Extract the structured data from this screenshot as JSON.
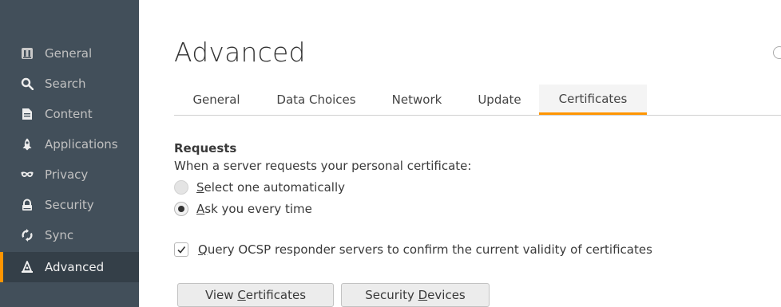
{
  "sidebar": {
    "items": [
      {
        "label": "General",
        "icon": "general-icon"
      },
      {
        "label": "Search",
        "icon": "search-icon"
      },
      {
        "label": "Content",
        "icon": "content-icon"
      },
      {
        "label": "Applications",
        "icon": "applications-icon"
      },
      {
        "label": "Privacy",
        "icon": "privacy-icon"
      },
      {
        "label": "Security",
        "icon": "security-icon"
      },
      {
        "label": "Sync",
        "icon": "sync-icon"
      },
      {
        "label": "Advanced",
        "icon": "advanced-icon",
        "active": true
      }
    ]
  },
  "main": {
    "title": "Advanced",
    "tabs": [
      {
        "label": "General"
      },
      {
        "label": "Data Choices"
      },
      {
        "label": "Network"
      },
      {
        "label": "Update"
      },
      {
        "label": "Certificates",
        "selected": true
      }
    ],
    "requests": {
      "heading": "Requests",
      "description": "When a server requests your personal certificate:",
      "options": [
        {
          "accesskey": "S",
          "rest": "elect one automatically",
          "checked": false
        },
        {
          "accesskey": "A",
          "rest": "sk you every time",
          "checked": true
        }
      ]
    },
    "ocsp": {
      "accesskey": "Q",
      "rest": "uery OCSP responder servers to confirm the current validity of certificates",
      "checked": true
    },
    "buttons": {
      "view_certificates": {
        "pre": "View ",
        "accesskey": "C",
        "post": "ertificates"
      },
      "security_devices": {
        "pre": "Security ",
        "accesskey": "D",
        "post": "evices"
      }
    }
  },
  "colors": {
    "sidebar_bg": "#424f5a",
    "sidebar_active_bg": "#343f48",
    "accent": "#ff9500"
  }
}
